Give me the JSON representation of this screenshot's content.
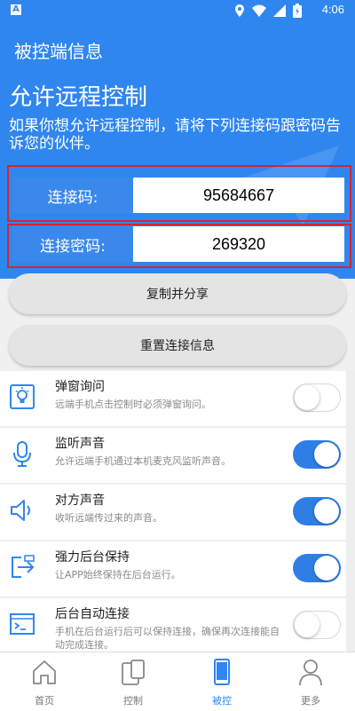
{
  "status_bar": {
    "time": "4:06",
    "app_badge": "A"
  },
  "app_bar": {
    "title": "被控端信息"
  },
  "hero": {
    "title": "允许远程控制",
    "description": "如果你想允许远程控制，请将下列连接码跟密码告诉您的伙伴。"
  },
  "connection": {
    "code_label": "连接码:",
    "code_value": "95684667",
    "password_label": "连接密码:",
    "password_value": "269320"
  },
  "actions": {
    "copy_share": "复制并分享",
    "reset_info": "重置连接信息"
  },
  "settings": [
    {
      "title": "弹窗询问",
      "desc": "远端手机点击控制时必须弹窗询问。",
      "enabled": false,
      "icon": "popup-bulb-icon"
    },
    {
      "title": "监听声音",
      "desc": "允许远端手机通过本机麦克风监听声音。",
      "enabled": true,
      "icon": "microphone-icon"
    },
    {
      "title": "对方声音",
      "desc": "收听远端传过来的声音。",
      "enabled": true,
      "icon": "speaker-icon"
    },
    {
      "title": "强力后台保持",
      "desc": "让APP始终保持在后台运行。",
      "enabled": true,
      "icon": "background-keep-icon"
    },
    {
      "title": "后台自动连接",
      "desc": "手机在后台运行后可以保持连接，确保再次连接能自动完成连接。",
      "enabled": false,
      "icon": "terminal-icon"
    }
  ],
  "bottom_nav": [
    {
      "label": "首页",
      "icon": "home-icon",
      "active": false
    },
    {
      "label": "控制",
      "icon": "devices-icon",
      "active": false
    },
    {
      "label": "被控",
      "icon": "phone-icon",
      "active": true
    },
    {
      "label": "更多",
      "icon": "person-icon",
      "active": false
    }
  ],
  "colors": {
    "primary": "#2f86ef",
    "highlight_border": "#d9232d",
    "toggle_on": "#2f7ee6"
  }
}
